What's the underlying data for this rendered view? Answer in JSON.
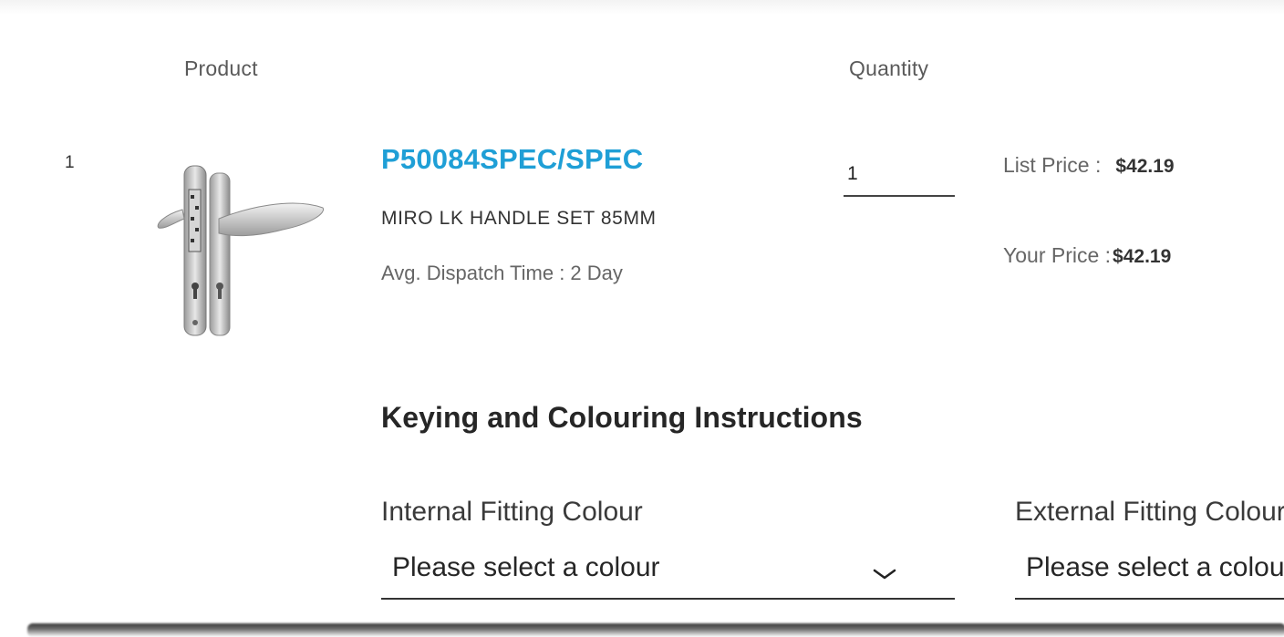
{
  "table": {
    "headers": {
      "product": "Product",
      "quantity": "Quantity"
    },
    "rows": [
      {
        "index": "1",
        "sku": "P50084SPEC/SPEC",
        "name": "MIRO LK HANDLE SET 85MM",
        "dispatch_label": "Avg. Dispatch Time :",
        "dispatch_value": "2 Day",
        "quantity": "1",
        "list_price_label": "List Price :",
        "list_price": "$42.19",
        "your_price_label": "Your Price :",
        "your_price": "$42.19"
      }
    ]
  },
  "keying": {
    "title": "Keying and Colouring Instructions",
    "internal_label": "Internal Fitting Colour",
    "internal_value": "Please select a colour",
    "external_label": "External Fitting Colour",
    "external_value": "Please select a colour"
  },
  "colors": {
    "sku_link": "#1f9fd6"
  }
}
